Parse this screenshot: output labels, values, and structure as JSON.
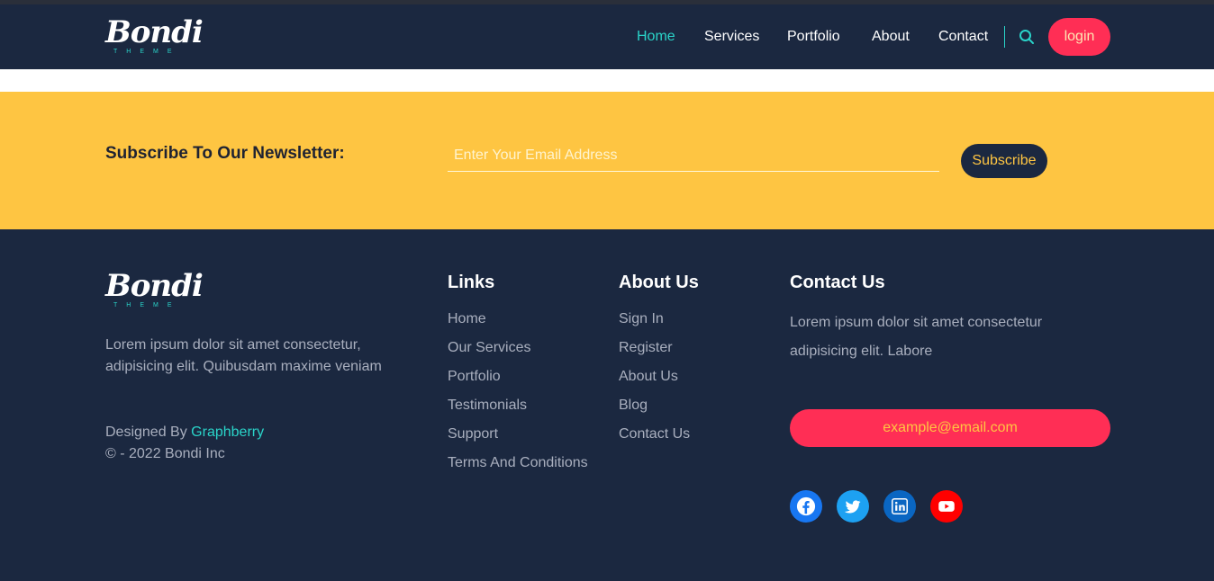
{
  "brand": {
    "name": "Bondi",
    "tagline": "THEME"
  },
  "nav": {
    "items": [
      {
        "label": "Home",
        "active": true
      },
      {
        "label": "Services",
        "active": false
      },
      {
        "label": "Portfolio",
        "active": false
      },
      {
        "label": "About",
        "active": false
      },
      {
        "label": "Contact",
        "active": false
      }
    ],
    "search_icon": "search-icon",
    "login_label": "login"
  },
  "newsletter": {
    "title": "Subscribe To Our Newsletter:",
    "email_placeholder": "Enter Your Email Address",
    "subscribe_label": "Subscribe"
  },
  "footer": {
    "about_text": "Lorem ipsum dolor sit amet consectetur, adipisicing elit. Quibusdam maxime veniam",
    "designed_by_prefix": "Designed By ",
    "designed_by_name": "Graphberry",
    "copyright": "© - 2022 Bondi Inc",
    "links": {
      "title": "Links",
      "items": [
        "Home",
        "Our Services",
        "Portfolio",
        "Testimonials",
        "Support",
        "Terms And Conditions"
      ]
    },
    "about_us": {
      "title": "About Us",
      "items": [
        "Sign In",
        "Register",
        "About Us",
        "Blog",
        "Contact Us"
      ]
    },
    "contact_us": {
      "title": "Contact Us",
      "text": "Lorem ipsum dolor sit amet consectetur adipisicing elit. Labore",
      "email": "example@email.com"
    },
    "social": [
      {
        "icon": "facebook-icon",
        "color": "#1877f2"
      },
      {
        "icon": "twitter-icon",
        "color": "#1da1f2"
      },
      {
        "icon": "linkedin-icon",
        "color": "#0a66c2"
      },
      {
        "icon": "youtube-icon",
        "color": "#ff0000"
      }
    ]
  },
  "colors": {
    "navy": "#1b2840",
    "accent_teal": "#2ad4c9",
    "accent_pink": "#ff2e55",
    "accent_yellow": "#fec542"
  }
}
